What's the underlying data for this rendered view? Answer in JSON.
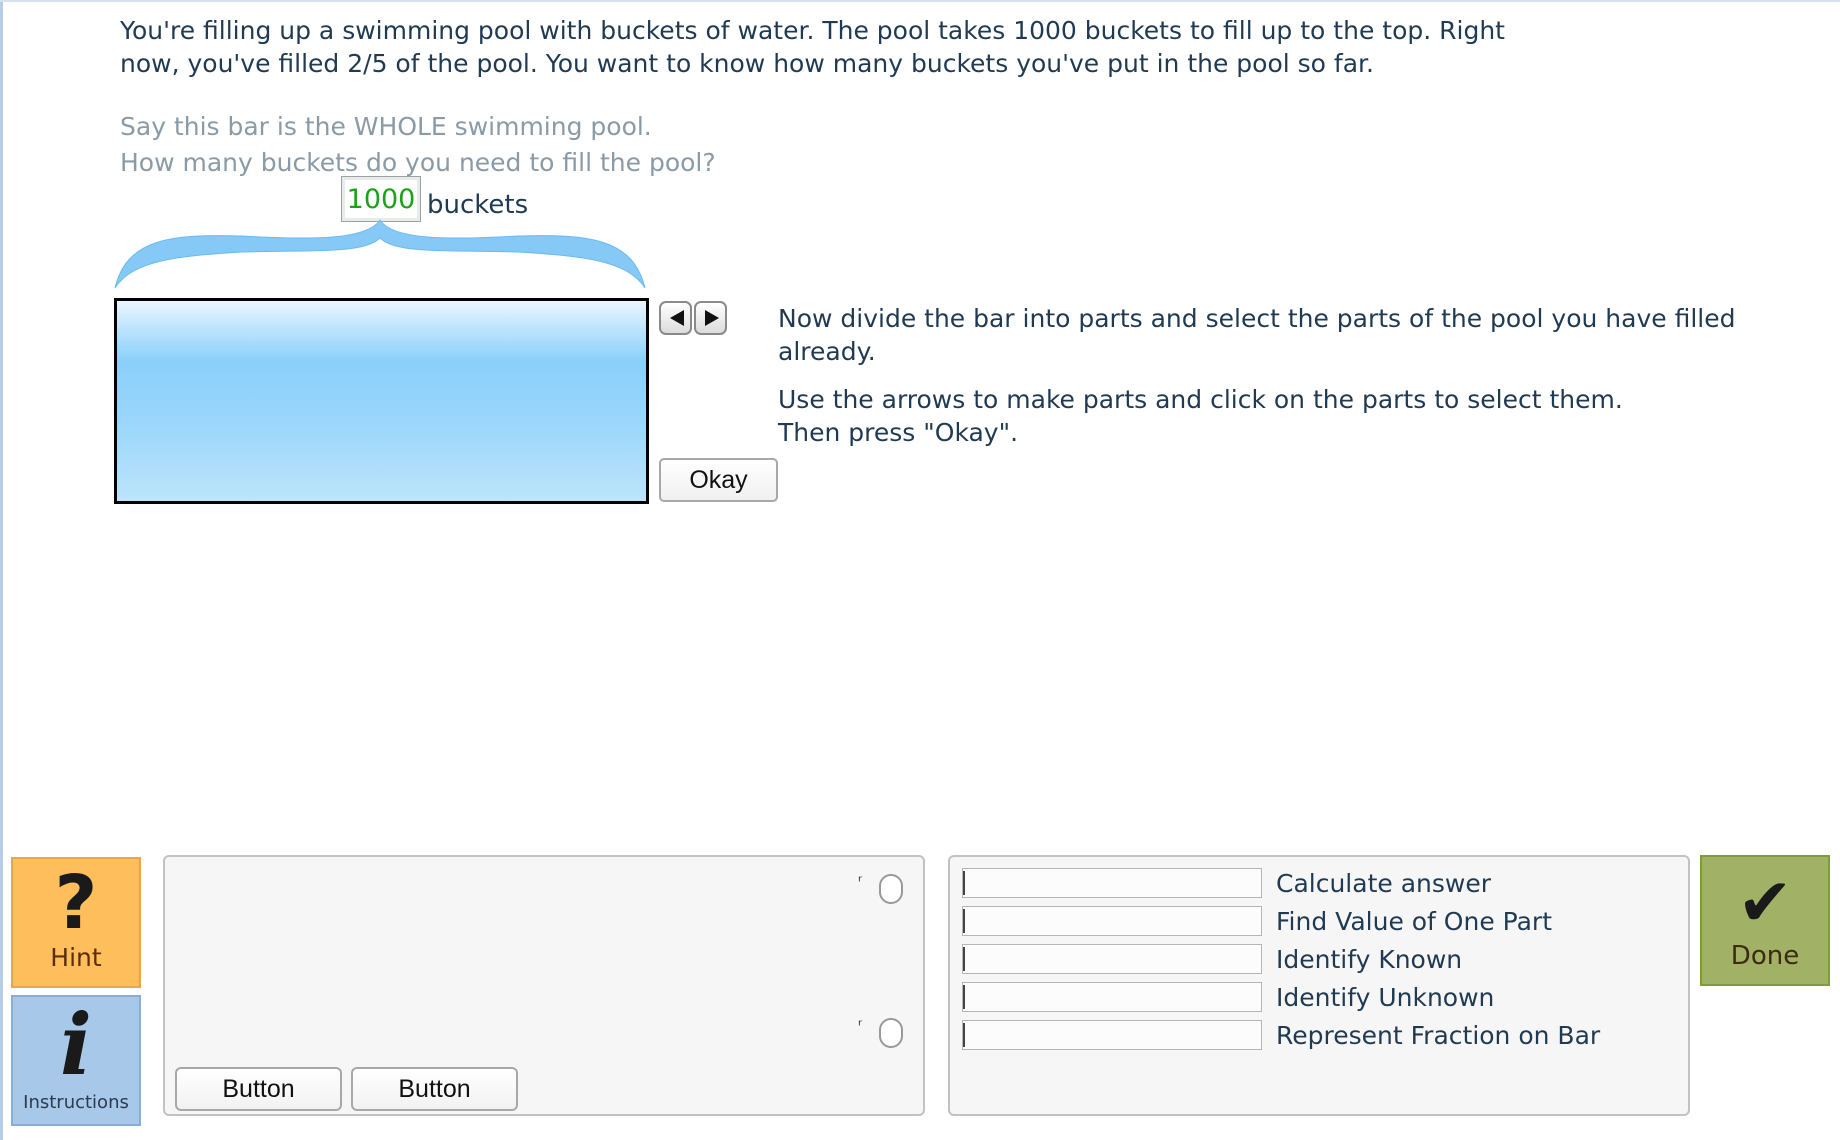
{
  "problem": {
    "text": "You're filling up a swimming pool with buckets of water. The pool takes 1000 buckets to fill up to the top. Right now, you've filled 2/5 of the pool. You want to know how many buckets you've put in the pool so far."
  },
  "prompt": {
    "line1": "Say this bar is the WHOLE swimming pool.",
    "line2": "How many buckets do you need to fill the pool?"
  },
  "whole": {
    "value": "1000",
    "unit": "buckets"
  },
  "instructions": {
    "line1": "Now divide the bar into parts and select the parts of the pool you have filled already.",
    "line2": "Use the arrows to make parts and click on the parts to select them.",
    "line3": "Then press \"Okay\"."
  },
  "okay_label": "Okay",
  "hint": {
    "label": "Hint",
    "icon": "question-mark-icon"
  },
  "instructions_button": {
    "label": "Instructions",
    "icon": "info-icon"
  },
  "done": {
    "label": "Done",
    "icon": "checkmark-icon"
  },
  "buttons": [
    "Button",
    "Button"
  ],
  "skills": [
    {
      "label": "Calculate answer"
    },
    {
      "label": "Find Value of One Part"
    },
    {
      "label": "Identify Known"
    },
    {
      "label": "Identify Unknown"
    },
    {
      "label": "Represent Fraction on Bar"
    }
  ],
  "colors": {
    "value_green": "#1aa31a",
    "pool_blue": "#8ad0fb",
    "hint_orange": "#ffbe5c",
    "instructions_blue": "#a7c8e8",
    "done_olive": "#a1b266"
  }
}
